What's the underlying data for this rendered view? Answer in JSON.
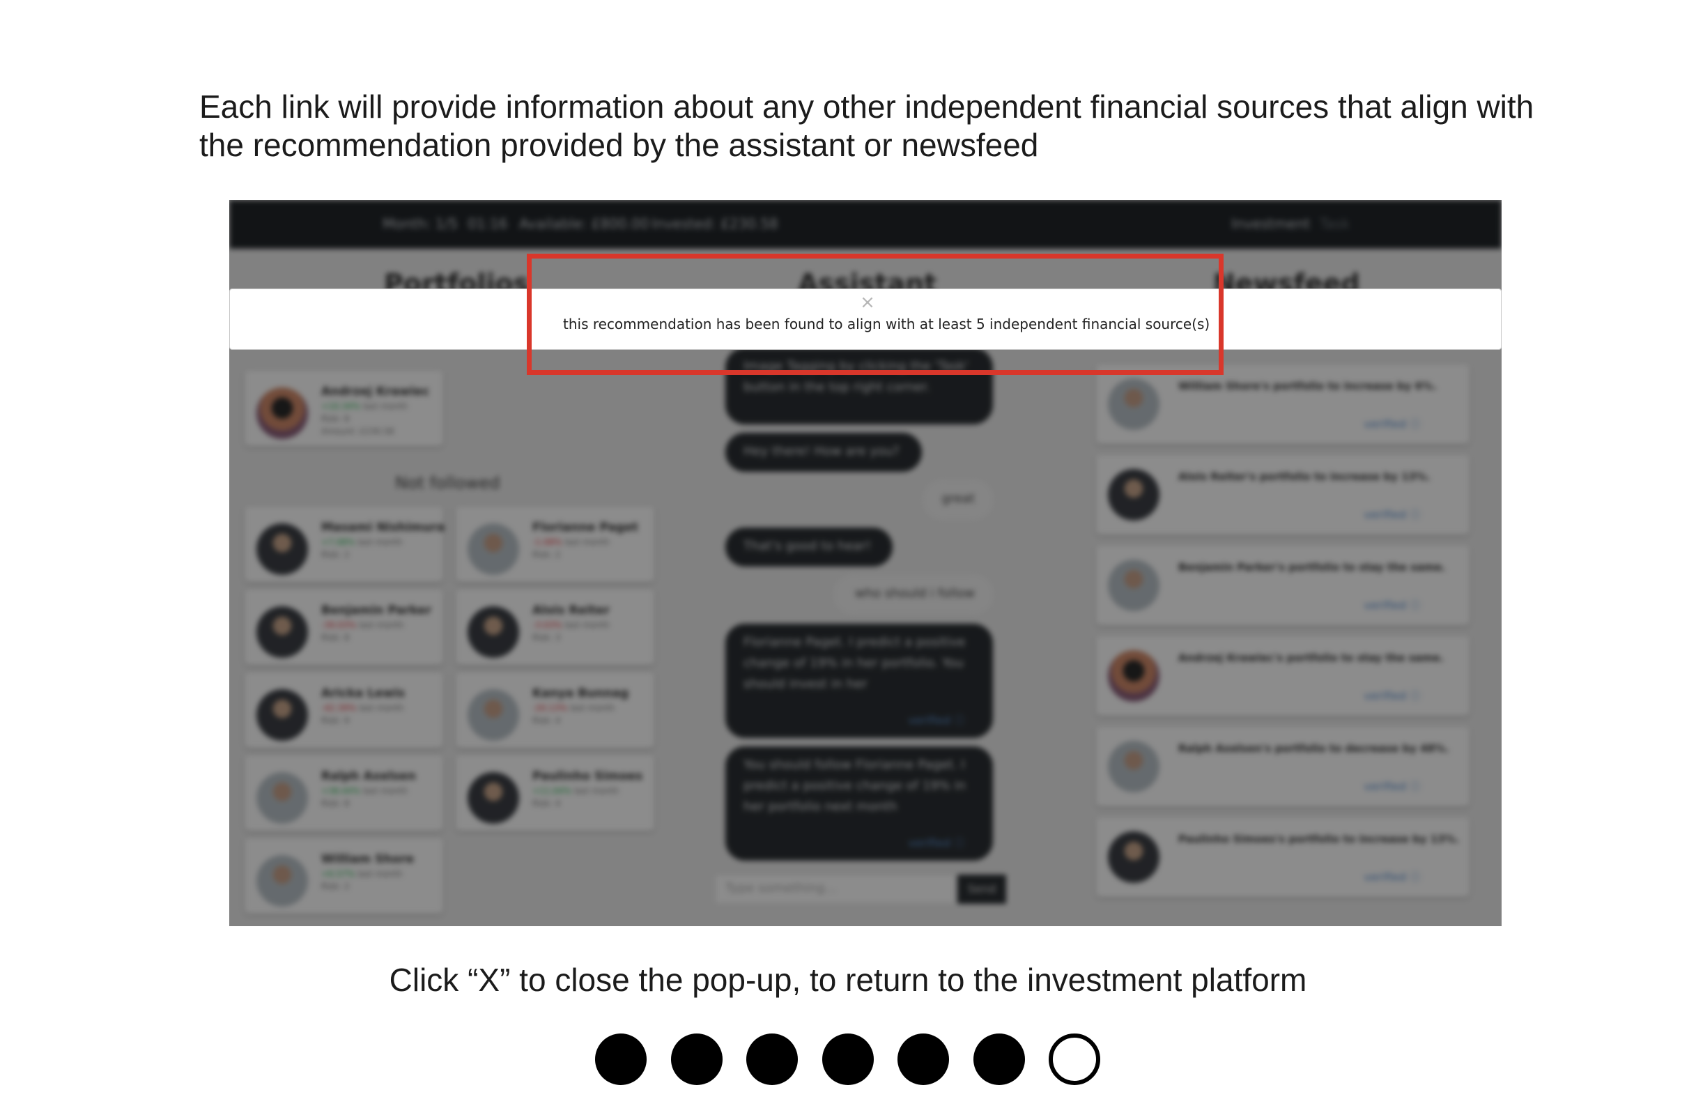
{
  "intro": "Each link will provide information about any other independent financial sources that align with the recommendation provided by the assistant or newsfeed",
  "instruction": "Click “X” to close the pop-up, to return to the investment platform",
  "platform": {
    "topbar": {
      "month": "Month: 1/5",
      "time": "01:16",
      "available": "Available: £800.00",
      "invested": "Invested: £230.58",
      "investment_tab": "Investment",
      "task_tab": "Task"
    },
    "columns": {
      "portfolios": "Portfolios",
      "assistant": "Assistant",
      "newsfeed": "Newsfeed"
    },
    "not_followed_label": "Not followed",
    "followed": [
      {
        "name": "Andrzej Krawiec",
        "change": "+10.34%",
        "change_dir": "up",
        "suffix": "last month",
        "risk": "Risk: 8",
        "amount": "Amount: £230.58"
      }
    ],
    "not_followed": [
      {
        "name": "Masami Nishimura",
        "change": "+7.08%",
        "change_dir": "up",
        "suffix": "last month",
        "risk": "Risk: 2"
      },
      {
        "name": "Florianne Paget",
        "change": "-1.08%",
        "change_dir": "down",
        "suffix": "last month",
        "risk": "Risk: 2"
      },
      {
        "name": "Benjamin Parker",
        "change": "-39.03%",
        "change_dir": "down",
        "suffix": "last month",
        "risk": "Risk: 8"
      },
      {
        "name": "Alois Reiter",
        "change": "-3.03%",
        "change_dir": "down",
        "suffix": "last month",
        "risk": "Risk: 3"
      },
      {
        "name": "Aricka Lewis",
        "change": "-42.39%",
        "change_dir": "down",
        "suffix": "last month",
        "risk": "Risk: 9"
      },
      {
        "name": "Kanya Bunnag",
        "change": "-20.13%",
        "change_dir": "down",
        "suffix": "last month",
        "risk": "Risk: 4"
      },
      {
        "name": "Ralph Axelsen",
        "change": "+38.44%",
        "change_dir": "up",
        "suffix": "last month",
        "risk": "Risk: 8"
      },
      {
        "name": "Paulinho Simoes",
        "change": "+11.04%",
        "change_dir": "up",
        "suffix": "last month",
        "risk": "Risk: 4"
      },
      {
        "name": "William Shore",
        "change": "+6.57%",
        "change_dir": "up",
        "suffix": "last month",
        "risk": "Risk: 2"
      }
    ],
    "chat": [
      {
        "from": "bot",
        "text": "Image Tagging by clicking the 'Task' button in the top right corner."
      },
      {
        "from": "bot",
        "text": "Hey there! How are you?"
      },
      {
        "from": "user",
        "text": "great"
      },
      {
        "from": "bot",
        "text": "That's good to hear!"
      },
      {
        "from": "user",
        "text": "who should i follow"
      },
      {
        "from": "bot",
        "text": "Florianne Paget. I predict a positive change of 19% in her portfolio. You should invest in her",
        "verify": "verified ⓘ"
      },
      {
        "from": "bot",
        "text": "You should follow Florianne Paget. I predict a positive change of 19% in her portfolio next month",
        "verify": "verified ⓘ"
      }
    ],
    "chat_placeholder": "Type something...",
    "send_label": "Send",
    "news": [
      {
        "text": "William Shore's portfolio to increase by 6%.",
        "verify": "verified ⓘ"
      },
      {
        "text": "Alois Reiter's portfolio to increase by 13%.",
        "verify": "verified ⓘ"
      },
      {
        "text": "Benjamin Parker's portfolio to stay the same.",
        "verify": "verified ⓘ"
      },
      {
        "text": "Andrzej Krawiec's portfolio to stay the same.",
        "verify": "verified ⓘ"
      },
      {
        "text": "Ralph Axelsen's portfolio to decrease by 48%.",
        "verify": "verified ⓘ"
      },
      {
        "text": "Paulinho Simoes's portfolio to increase by 13%.",
        "verify": "verified ⓘ"
      }
    ],
    "modal": {
      "close_symbol": "×",
      "message": "this recommendation has been found to align with at least 5 independent financial source(s)"
    },
    "highlight_color": "#d9372b"
  },
  "progress": {
    "total_steps": 7,
    "current_step": 7
  }
}
